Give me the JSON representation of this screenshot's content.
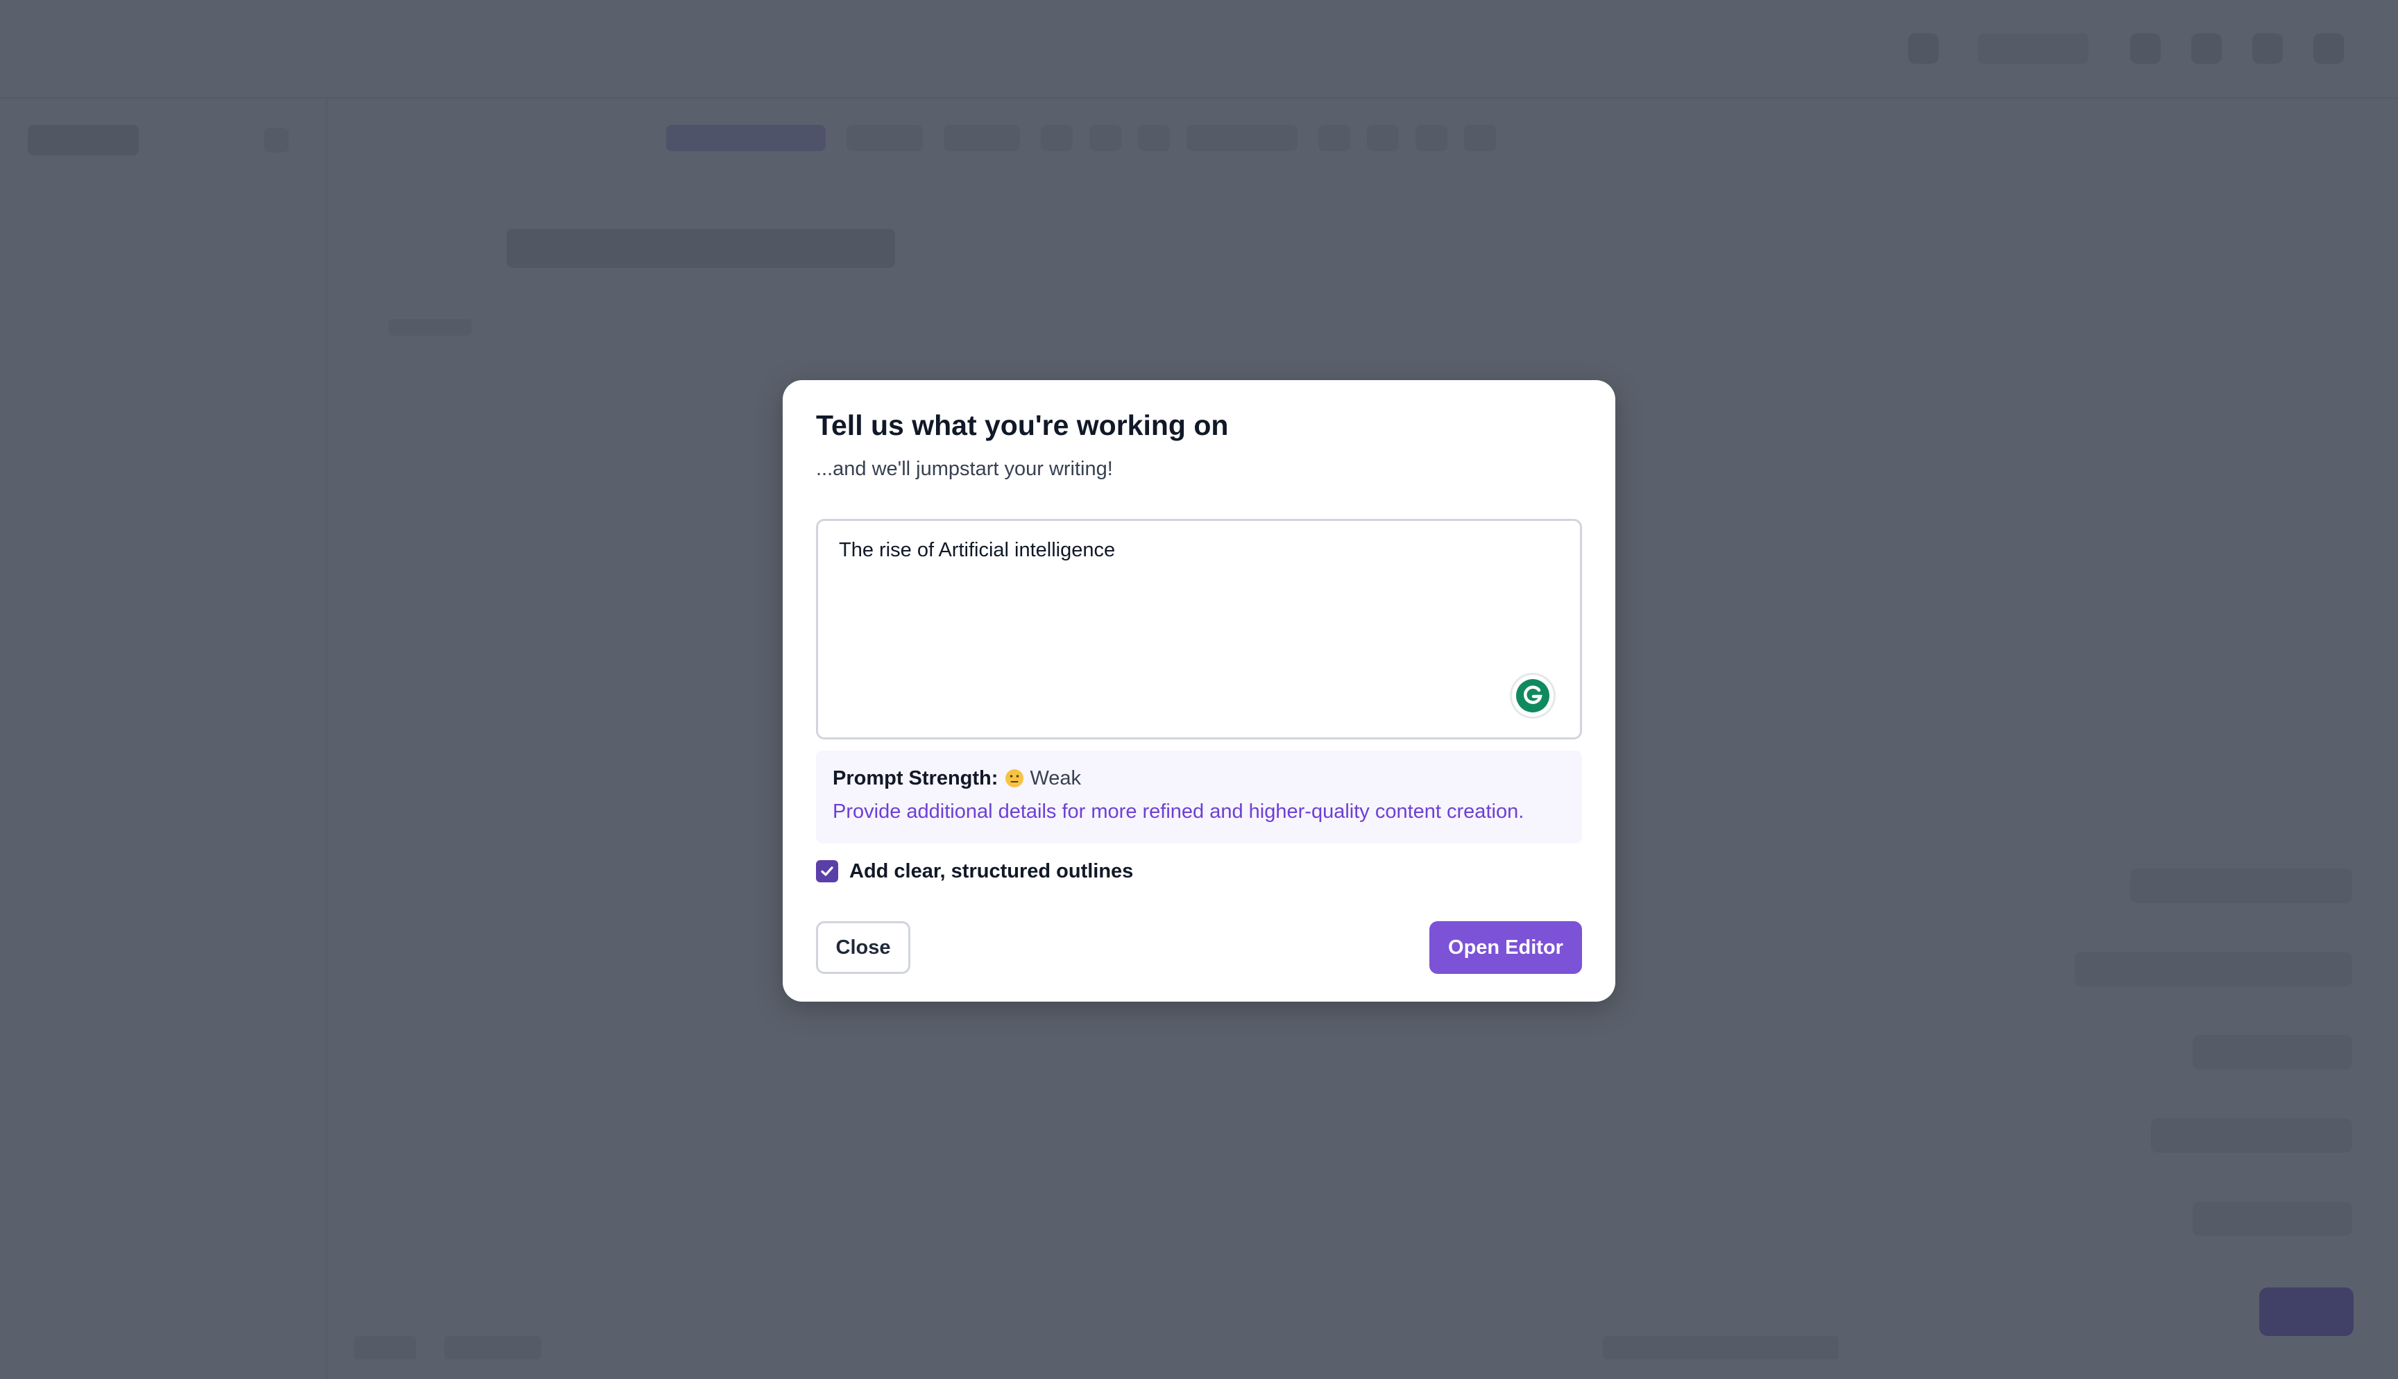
{
  "modal": {
    "title": "Tell us what you're working on",
    "subtitle": "...and we'll jumpstart your writing!",
    "prompt": {
      "value": "The rise of Artificial intelligence"
    },
    "prompt_strength": {
      "label": "Prompt Strength:",
      "emoji": "😐",
      "value": "Weak",
      "hint": "Provide additional details for more refined and higher-quality content creation."
    },
    "outline_option": {
      "label": "Add clear, structured outlines",
      "checked": true
    },
    "buttons": {
      "close": "Close",
      "open_editor": "Open Editor"
    }
  },
  "colors": {
    "accent": "#7c52d6",
    "checkbox": "#5b3fa8",
    "hint_text": "#6d3fd6",
    "overlay": "#2d3442",
    "grammarly_green": "#15a06a"
  },
  "icons": {
    "grammarly": "grammarly-icon",
    "check": "check-icon",
    "strength_face": "neutral-face-icon"
  }
}
